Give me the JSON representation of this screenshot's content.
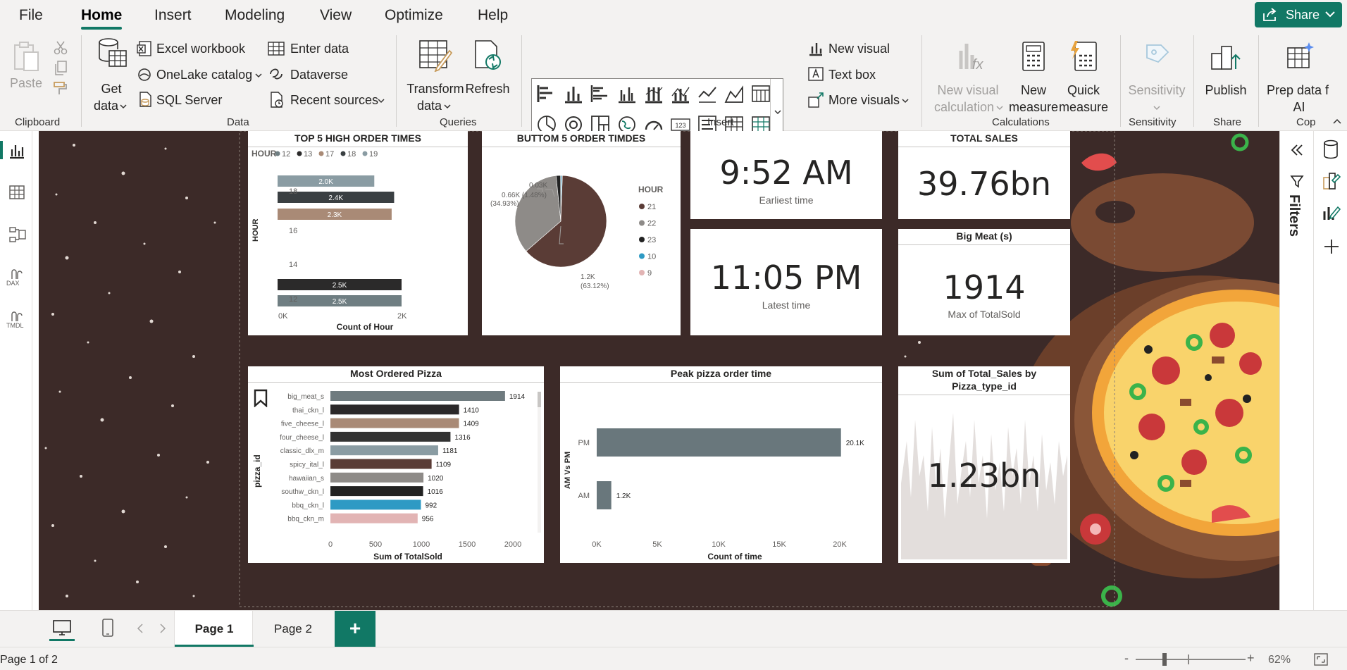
{
  "menu": {
    "items": [
      "File",
      "Home",
      "Insert",
      "Modeling",
      "View",
      "Optimize",
      "Help"
    ],
    "share": "Share"
  },
  "ribbon": {
    "paste": "Paste",
    "get_data": [
      "Get",
      "data"
    ],
    "excel": "Excel workbook",
    "onelake": "OneLake catalog",
    "sql": "SQL Server",
    "enter_data": "Enter data",
    "dataverse": "Dataverse",
    "recent_sources": "Recent sources",
    "transform": [
      "Transform",
      "data"
    ],
    "refresh": "Refresh",
    "new_visual": "New visual",
    "text_box": "Text box",
    "more_visuals": "More visuals",
    "new_visual_calc": [
      "New visual",
      "calculation"
    ],
    "new_measure": [
      "New",
      "measure"
    ],
    "quick_measure": [
      "Quick",
      "measure"
    ],
    "sensitivity": "Sensitivity",
    "publish": "Publish",
    "prep_data": [
      "Prep data f",
      "AI"
    ],
    "groups": {
      "clipboard": "Clipboard",
      "data": "Data",
      "queries": "Queries",
      "insert": "Insert",
      "calculations": "Calculations",
      "sensitivity": "Sensitivity",
      "share": "Share",
      "copilot": "Cop"
    }
  },
  "leftnav": {
    "dax": "DAX",
    "tmdl": "TMDL"
  },
  "filters": {
    "label": "Filters"
  },
  "visuals": {
    "top5": {
      "title": "TOP 5 HIGH ORDER TIMES",
      "legend_title": "HOUR",
      "legend": [
        {
          "label": "12",
          "color": "#6f7e82"
        },
        {
          "label": "13",
          "color": "#2b2a2a"
        },
        {
          "label": "17",
          "color": "#a98a76"
        },
        {
          "label": "18",
          "color": "#3a3f42"
        },
        {
          "label": "19",
          "color": "#8a9ca3"
        }
      ],
      "ylabel": "HOUR",
      "xlabel": "Count of Hour",
      "ytick_labels": [
        "18",
        "16",
        "14",
        "12"
      ],
      "xtick_labels": [
        "0K",
        "2K"
      ]
    },
    "bottom5": {
      "title": "BUTTOM 5 ORDER TIMDES",
      "legend_title": "HOUR",
      "legend": [
        {
          "label": "21",
          "color": "#5a3c36"
        },
        {
          "label": "22",
          "color": "#8e8b88"
        },
        {
          "label": "23",
          "color": "#222222"
        },
        {
          "label": "10",
          "color": "#2e9ac4"
        },
        {
          "label": "9",
          "color": "#e2b4b4"
        }
      ],
      "label_small": "0.03K",
      "label_mid": "0.66K (1.48%)",
      "label_mid2": "(34.93%)",
      "label_big": "1.2K",
      "label_big2": "(63.12%)"
    },
    "earliest": {
      "value": "9:52 AM",
      "label": "Earliest time"
    },
    "latest": {
      "value": "11:05 PM",
      "label": "Latest time"
    },
    "total_sales": {
      "title": "TOTAL SALES",
      "value": "39.76bn"
    },
    "big_meat": {
      "title": "Big Meat (s)",
      "value": "1914",
      "label": "Max of TotalSold"
    },
    "most_ordered": {
      "title": "Most Ordered Pizza",
      "ylabel": "pizza_id",
      "xlabel": "Sum of TotalSold",
      "xtick_labels": [
        "0",
        "500",
        "1000",
        "1500",
        "2000"
      ]
    },
    "peak": {
      "title": "Peak pizza order time",
      "ylabel": "AM Vs PM",
      "xlabel": "Count of time",
      "xtick_labels": [
        "0K",
        "5K",
        "10K",
        "15K",
        "20K"
      ]
    },
    "sum_sales": {
      "title": [
        "Sum of Total_Sales by",
        "Pizza_type_id"
      ],
      "value": "1.23bn"
    }
  },
  "chart_data": [
    {
      "type": "bar",
      "title": "TOP 5 HIGH ORDER TIMES",
      "categories": [
        "19",
        "18",
        "17",
        "13",
        "12"
      ],
      "values": [
        1.95,
        2.35,
        2.3,
        2.5,
        2.5
      ],
      "data_labels": [
        "2.0K",
        "2.4K",
        "2.3K",
        "2.5K",
        "2.5K"
      ],
      "colors": [
        "#8a9ca3",
        "#3a3f42",
        "#a98a76",
        "#2b2a2a",
        "#6f7e82"
      ],
      "xlabel": "Count of Hour",
      "ylabel": "HOUR",
      "xlim": [
        0,
        3
      ]
    },
    {
      "type": "pie",
      "title": "BUTTOM 5 ORDER TIMDES",
      "categories": [
        "21",
        "22",
        "23",
        "10",
        "9"
      ],
      "values": [
        1.2,
        0.66,
        0.03,
        0.008,
        0.004
      ],
      "percent_labels": [
        "63.12%",
        "34.93%",
        "1.48%"
      ],
      "colors": [
        "#5a3c36",
        "#8e8b88",
        "#222222",
        "#2e9ac4",
        "#e2b4b4"
      ]
    },
    {
      "type": "bar",
      "title": "Most Ordered Pizza",
      "categories": [
        "big_meat_s",
        "thai_ckn_l",
        "five_cheese_l",
        "four_cheese_l",
        "classic_dlx_m",
        "spicy_ital_l",
        "hawaiian_s",
        "southw_ckn_l",
        "bbq_ckn_l",
        "bbq_ckn_m"
      ],
      "values": [
        1914,
        1410,
        1409,
        1316,
        1181,
        1109,
        1020,
        1016,
        992,
        956
      ],
      "colors": [
        "#6f7b7f",
        "#2b2829",
        "#a98a76",
        "#333333",
        "#8a9ca3",
        "#5a3c36",
        "#8e8b88",
        "#222222",
        "#2e9ac4",
        "#e2b4b4"
      ],
      "xlabel": "Sum of TotalSold",
      "ylabel": "pizza_id",
      "xlim": [
        0,
        2100
      ]
    },
    {
      "type": "bar",
      "title": "Peak pizza order time",
      "categories": [
        "PM",
        "AM"
      ],
      "values": [
        20.1,
        1.2
      ],
      "data_labels": [
        "20.1K",
        "1.2K"
      ],
      "xlabel": "Count of time",
      "ylabel": "AM Vs PM",
      "xlim": [
        0,
        22
      ]
    }
  ],
  "tabs": {
    "pages": [
      "Page 1",
      "Page 2"
    ],
    "add": "+"
  },
  "status": {
    "page": "Page 1 of 2",
    "minus": "-",
    "plus": "+",
    "zoom": "62%"
  }
}
